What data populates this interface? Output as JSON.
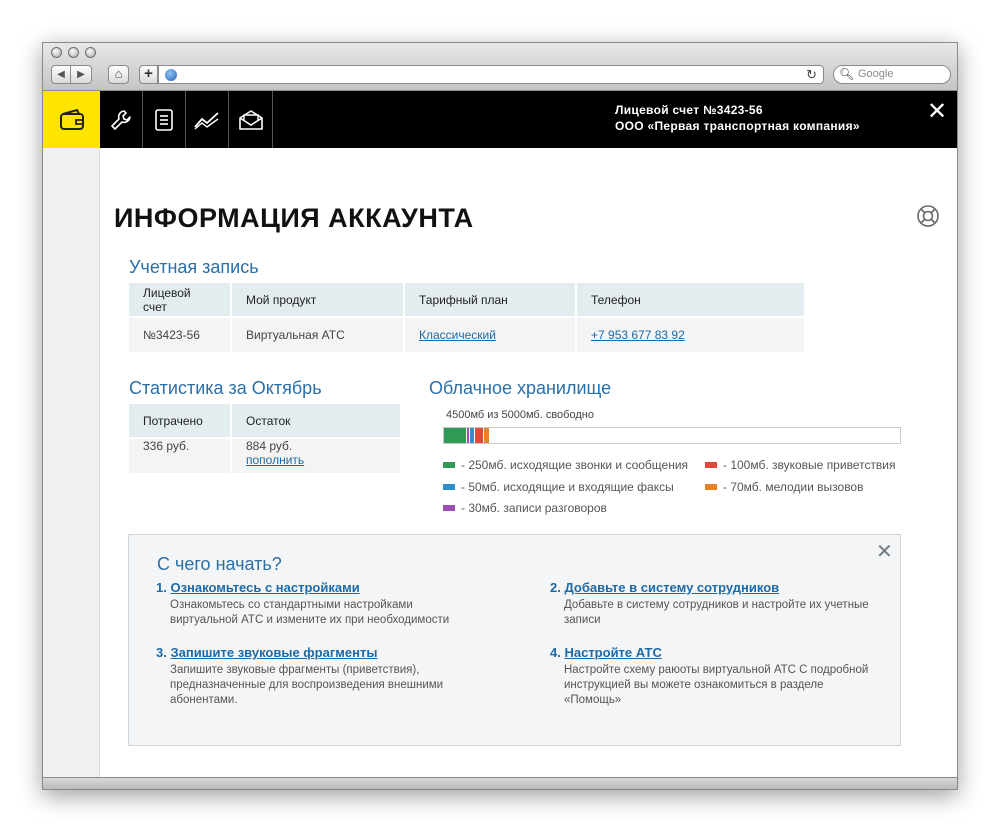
{
  "browser": {
    "search_placeholder": "Google",
    "reload_icon": "reload-icon",
    "back_label": "◀",
    "forward_label": "▶",
    "home_label": "⌂",
    "add_label": "+"
  },
  "topbar": {
    "account_line": "Лицевой счет №3423-56",
    "company": "ООО «Первая транспортная компания»",
    "close_label": "✕",
    "accent_color": "#ffe400",
    "icons": [
      "wallet-icon",
      "wrench-icon",
      "notebook-icon",
      "chart-icon",
      "mail-icon"
    ]
  },
  "page": {
    "title": "ИНФОРМАЦИЯ АККАУНТА"
  },
  "account": {
    "heading": "Учетная запись",
    "columns": [
      "Лицевой счет",
      "Мой продукт",
      "Тарифный план",
      "Телефон"
    ],
    "values": [
      "№3423-56",
      "Виртуальная АТС",
      "Классический",
      "+7 953 677 83 92"
    ]
  },
  "stats": {
    "heading": "Статистика за Октябрь",
    "columns": [
      "Потрачено",
      "Остаток"
    ],
    "spent": "336 руб.",
    "balance": "884 руб.",
    "top_up": "пополнить"
  },
  "cloud": {
    "heading": "Облачное хранилище",
    "summary": "4500мб из 5000мб. свободно",
    "total_mb": 5000,
    "segments": [
      {
        "mb": 250,
        "color": "#2e9a56",
        "label": "- 250мб. исходящие звонки и сообщения"
      },
      {
        "mb": 30,
        "color": "#9b4fb3",
        "label": "- 30мб. записи разговоров"
      },
      {
        "mb": 50,
        "color": "#2f8fc6",
        "label": "- 50мб. исходящие и входящие факсы"
      },
      {
        "mb": 100,
        "color": "#e04a3c",
        "label": "- 100мб. звуковые приветствия"
      },
      {
        "mb": 70,
        "color": "#e5822b",
        "label": "- 70мб. мелодии вызовов"
      }
    ]
  },
  "start": {
    "title": "С чего начать?",
    "close_label": "✕",
    "steps": [
      {
        "num": "1.",
        "title": "Ознакомьтесь с настройками",
        "desc": "Ознакомьтесь со стандартными настройками виртуальной АТС и измените их при необходимости"
      },
      {
        "num": "2.",
        "title": "Добавьте в систему сотрудников",
        "desc": "Добавьте в систему сотрудников и настройте их учетные записи"
      },
      {
        "num": "3.",
        "title": "Запишите звуковые фрагменты",
        "desc": "Запишите звуковые фрагменты (приветствия), предназначенные для воспроизведения внешними абонентами."
      },
      {
        "num": "4.",
        "title": "Настройте АТС",
        "desc": "Настройте схему раюоты виртуальной АТС С подробной инструкцией вы можете ознакомиться в разделе «Помощь»"
      }
    ]
  }
}
